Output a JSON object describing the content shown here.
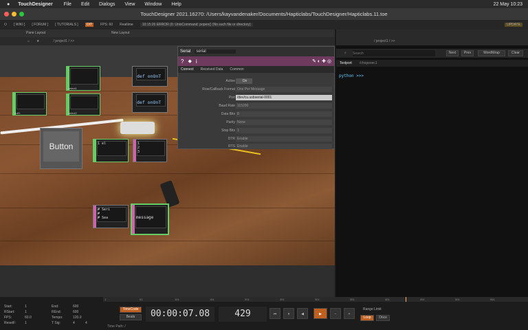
{
  "menubar": {
    "app": "TouchDesigner",
    "items": [
      "File",
      "Edit",
      "Dialogs",
      "View",
      "Window",
      "Help"
    ],
    "clock": "22 May  10:23"
  },
  "window": {
    "title": "TouchDesigner 2021.16270: /Users/kayvandenaker/Documents/Hapticlabs/TouchDesigner/Hapticlabs.11.toe"
  },
  "tdbar": {
    "wiki": "[ WIKI ]",
    "forum": "[ FORUM ]",
    "tutorials": "[ TUTORIALS ]",
    "oit": "OIT",
    "fps": "FPS:  60",
    "realtime": "Realtime",
    "error": "10:15:26 ERROR (0: UnixCommand: popen() (No such file or directory)",
    "update": "UPDATE"
  },
  "pane": {
    "pane_layout": "Pane Layout",
    "new_layout": "New Layout",
    "path": "/ project1 / >>"
  },
  "nodes": {
    "button_text": "Button",
    "code1": "def onOnT",
    "code2": "def onOnT",
    "nodeA": "1  el",
    "nodeB": "1\n2\n3",
    "msgA": "# Seri\n#\n# Sea",
    "msgB": "message"
  },
  "param": {
    "op_type": "Serial",
    "op_name": "serial",
    "tabs": [
      "Connect",
      "Received Data",
      "Common"
    ],
    "rows": [
      {
        "label": "Active",
        "value": "On"
      },
      {
        "label": "Row/Callback Format",
        "value": "One Per Message"
      },
      {
        "label": "Port",
        "value": "/dev/cu.usbserial-0001"
      },
      {
        "label": "Baud Rate",
        "value": "115200"
      },
      {
        "label": "Data Bits",
        "value": "8"
      },
      {
        "label": "Parity",
        "value": "None"
      },
      {
        "label": "Stop Bits",
        "value": "1"
      },
      {
        "label": "DTR",
        "value": "Enable"
      },
      {
        "label": "RTS",
        "value": "Enable"
      }
    ]
  },
  "textport": {
    "path": "/ project1 / >>",
    "search_placeholder": "Search",
    "next": "Next",
    "prev": "Prev",
    "wordwrap": "WordWrap",
    "clear": "Clear",
    "tab1": "Textport",
    "tab2": "/chopexec1",
    "prompt": "python >>>"
  },
  "timeline": {
    "start_lbl": "Start:",
    "start": "1",
    "end_lbl": "End:",
    "end": "600",
    "rstart_lbl": "RStart:",
    "rstart": "1",
    "rend_lbl": "REnd:",
    "rend": "600",
    "fps_lbl": "FPS:",
    "fps": "60.0",
    "tempo_lbl": "Tempo:",
    "tempo": "120.0",
    "reset_lbl": "ResetF:",
    "reset": "1",
    "tsig_lbl": "T Sig:",
    "tsig1": "4",
    "tsig2": "4",
    "timecode": "TimeCode",
    "beats": "Beats",
    "time": "00:00:07.08",
    "frame": "429",
    "range": "Range Limit",
    "loop": "Loop",
    "once": "Once",
    "timepath": "Time Path: /",
    "ticks": [
      "1",
      "51",
      "101",
      "151",
      "201",
      "251",
      "301",
      "351",
      "401",
      "451",
      "501",
      "551"
    ]
  }
}
